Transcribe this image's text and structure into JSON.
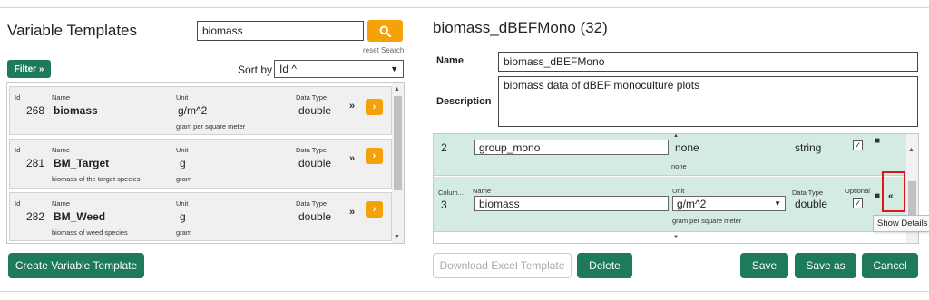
{
  "left": {
    "title": "Variable Templates",
    "search": {
      "value": "biomass",
      "reset_label": "reset Search"
    },
    "filter_label": "Filter »",
    "sort": {
      "label": "Sort by",
      "value": "Id ^"
    },
    "column_labels": {
      "id": "Id",
      "name": "Name",
      "unit": "Unit",
      "data_type": "Data Type"
    },
    "items": [
      {
        "id": "268",
        "name": "biomass",
        "description": "",
        "unit": "g/m^2",
        "unit_desc": "gram per square meter",
        "data_type": "double"
      },
      {
        "id": "281",
        "name": "BM_Target",
        "description": "biomass of the target species",
        "unit": "g",
        "unit_desc": "gram",
        "data_type": "double"
      },
      {
        "id": "282",
        "name": "BM_Weed",
        "description": "biomass of weed species",
        "unit": "g",
        "unit_desc": "gram",
        "data_type": "double"
      }
    ],
    "create_button": "Create Variable Template"
  },
  "right": {
    "title": "biomass_dBEFMono (32)",
    "name_label": "Name",
    "name_value": "biomass_dBEFMono",
    "description_label": "Description",
    "description_value": "biomass data of dBEF monoculture plots",
    "columns": [
      {
        "number": "2",
        "name": "group_mono",
        "unit": "none",
        "unit_desc": "none",
        "data_type": "string",
        "checked": true
      },
      {
        "number": "3",
        "name": "biomass",
        "unit": "g/m^2",
        "unit_desc": "gram per square meter",
        "data_type": "double",
        "checked": true
      }
    ],
    "column_labels": {
      "column": "Colum...",
      "name": "Name",
      "unit": "Unit",
      "data_type": "Data Type",
      "optional": "Optional"
    },
    "tooltip": "Show Details",
    "buttons": {
      "download": "Download Excel Template",
      "delete": "Delete",
      "save": "Save",
      "save_as": "Save as",
      "cancel": "Cancel"
    }
  },
  "colors": {
    "accent_orange": "#f5a10a",
    "primary_green": "#1d7a5b",
    "row_green": "#d4ebe2",
    "highlight_red": "#e0141e"
  }
}
